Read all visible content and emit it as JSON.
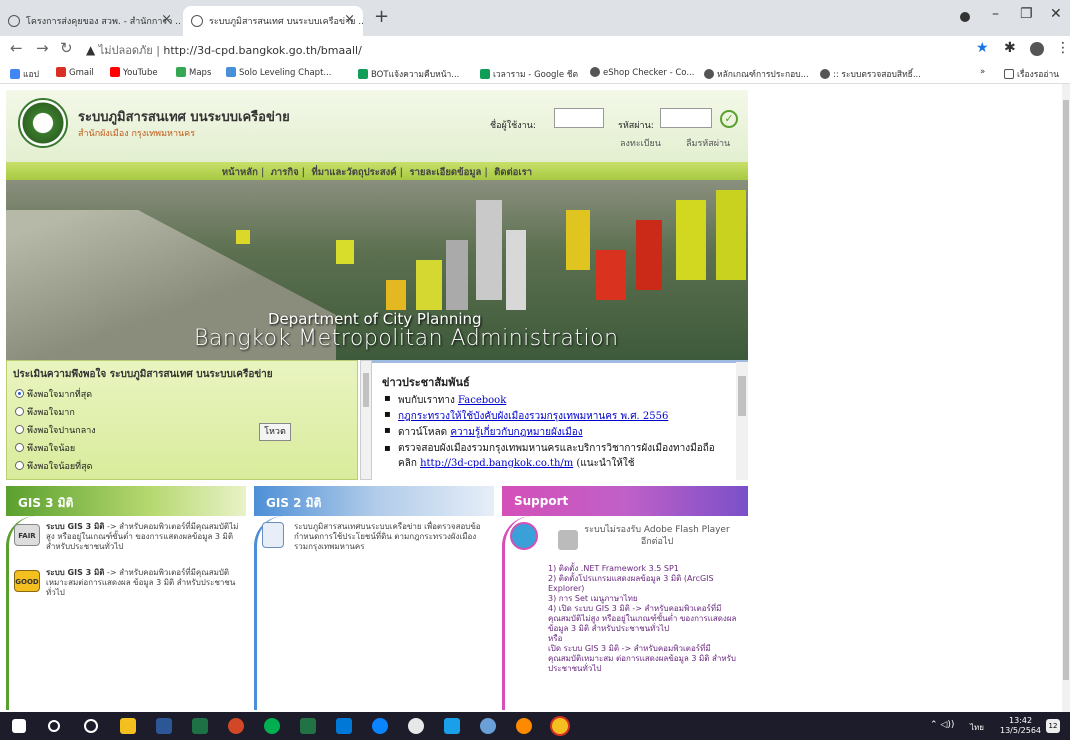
{
  "browser": {
    "tabs": [
      {
        "label": "โครงการส่งคุยของ สวพ. - สำนักการว ..."
      },
      {
        "label": "ระบบภูมิสารสนเทศ บนระบบเครือข่าย ..."
      }
    ],
    "new_tab": "+",
    "url_warning": "ไม่ปลอดภัย",
    "url": "http://3d-cpd.bangkok.go.th/bmaall/",
    "bookmarks": [
      {
        "label": "แอป",
        "color": "#4285f4"
      },
      {
        "label": "Gmail",
        "color": "#d93025"
      },
      {
        "label": "YouTube",
        "color": "#ff0000"
      },
      {
        "label": "Maps",
        "color": "#34a853"
      },
      {
        "label": "Solo Leveling Chapt...",
        "color": "#4a90d9"
      },
      {
        "label": "BOTแจ้งความคืบหน้า...",
        "color": "#0f9d58"
      },
      {
        "label": "เวลาราม - Google ชีต",
        "color": "#0f9d58"
      },
      {
        "label": "eShop Checker - Co...",
        "color": "#555555"
      },
      {
        "label": "หลักเกณฑ์การประกอบ...",
        "color": "#555555"
      },
      {
        "label": ":: ระบบตรวจสอบสิทธิ์...",
        "color": "#555555"
      }
    ],
    "more_bookmarks": "»",
    "reading_list": "เรื่องรออ่าน"
  },
  "site": {
    "title": "ระบบภูมิสารสนเทศ บนระบบเครือข่าย",
    "subtitle": "สำนักผังเมือง กรุงเทพมหานคร",
    "username_label": "ชื่อผู้ใช้งาน:",
    "password_label": "รหัสผ่าน:",
    "register": "ลงทะเบียน",
    "forgot": "ลืมรหัสผ่าน",
    "menu": [
      "หน้าหลัก",
      "ภารกิจ",
      "ที่มาและวัตถุประสงค์",
      "รายละเอียดข้อมูล",
      "ติดต่อเรา"
    ],
    "banner_line1": "Department of City Planning",
    "banner_line2": "Bangkok Metropolitan Administration"
  },
  "poll": {
    "title": "ประเมินความพึงพอใจ ระบบภูมิสารสนเทศ บนระบบเครือข่าย",
    "options": [
      "พึงพอใจมากที่สุด",
      "พึงพอใจมาก",
      "พึงพอใจปานกลาง",
      "พึงพอใจน้อย",
      "พึงพอใจน้อยที่สุด"
    ],
    "selected": 0,
    "vote": "โหวต"
  },
  "news": {
    "title": "ข่าวประชาสัมพันธ์",
    "items": [
      {
        "pre": "พบกับเราทาง ",
        "link": "Facebook"
      },
      {
        "pre": "",
        "link": "กฎกระทรวงให้ใช้บังคับผังเมืองรวมกรุงเทพมหานคร พ.ศ. 2556"
      },
      {
        "pre": "ดาวน์โหลด ",
        "link": "ความรู้เกี่ยวกับกฎหมายผังเมือง"
      },
      {
        "pre": "ตรวจสอบผังเมืองรวมกรุงเทพมหานครและบริการวิชาการผังเมืองทางมือถือ คลิก ",
        "link": "http://3d-cpd.bangkok.co.th/m",
        "post": " (แนะนำให้ใช้"
      }
    ]
  },
  "gis3d": {
    "title": "GIS 3 มิติ",
    "item1_badge": "FAIR",
    "item1_bold": "ระบบ GIS 3 มิติ",
    "item1_text": " -> สำหรับคอมพิวเตอร์ที่มีคุณสมบัติไม่สูง หรืออยู่ในเกณฑ์ขั้นต่ำ ของการแสดงผลข้อมูล 3 มิติ สำหรับประชาชนทั่วไป",
    "item2_badge": "GOOD",
    "item2_bold": "ระบบ GIS 3 มิติ",
    "item2_text": " -> สำหรับคอมพิวเตอร์ที่มีคุณสมบัติเหมาะสมต่อการแสดงผล ข้อมูล 3 มิติ สำหรับประชาชนทั่วไป"
  },
  "gis2d": {
    "title": "GIS 2 มิติ",
    "text": "ระบบภูมิสารสนเทศบนระบบเครือข่าย เพื่อตรวจสอบข้อกำหนดการใช้ประโยชน์ที่ดิน ตามกฎกระทรวงผังเมืองรวมกรุงเทพมหานคร"
  },
  "support": {
    "title": "Support",
    "note": "ระบบไม่รองรับ Adobe Flash Player อีกต่อไป",
    "steps": [
      "1) ติดตั้ง .NET Framework 3.5 SP1",
      "2) ติดตั้งโปรแกรมแสดงผลข้อมูล 3 มิติ (ArcGIS Explorer)",
      "3) การ Set เมนูภาษาไทย",
      "4) เปิด ระบบ GIS 3 มิติ -> สำหรับคอมพิวเตอร์ที่มีคุณสมบัติไม่สูง หรืออยู่ในเกณฑ์ขั้นต่ำ ของการแสดงผลข้อมูล 3 มิติ สำหรับประชาชนทั่วไป",
      "หรือ",
      "เปิด ระบบ GIS 3 มิติ -> สำหรับคอมพิวเตอร์ที่มีคุณสมบัติเหมาะสม ต่อการแสดงผลข้อมูล 3 มิติ สำหรับประชาชนทั่วไป"
    ]
  },
  "taskbar": {
    "lang": "ไทย",
    "time": "13:42",
    "date": "13/5/2564",
    "notif": "12"
  },
  "colors": {
    "gis3d": "#5aa02e",
    "gis2d": "#4d8fd6",
    "support": "#d44fb8",
    "menu": "#a7c942"
  }
}
